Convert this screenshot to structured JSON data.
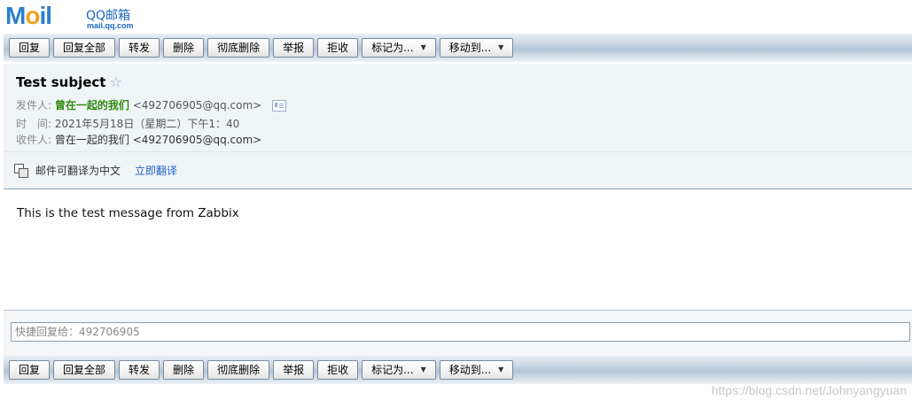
{
  "logo": {
    "text_m": "M",
    "text_o": "o",
    "text_il": "il",
    "cn": "QQ邮箱",
    "sub": "mail.qq.com"
  },
  "toolbar": {
    "reply": "回复",
    "reply_all": "回复全部",
    "forward": "转发",
    "delete": "删除",
    "delete_permanently": "彻底删除",
    "report": "举报",
    "reject": "拒收",
    "mark_as": "标记为...",
    "move_to": "移动到..."
  },
  "message": {
    "subject": "Test subject",
    "star": "☆",
    "from_label": "发件人:",
    "from_name": "曾在一起的我们",
    "from_addr": "<492706905@qq.com>",
    "time_label": "时　间:",
    "time_value": "2021年5月18日（星期二）下午1：40",
    "to_label": "收件人:",
    "to_value": "曾在一起的我们 <492706905@qq.com>",
    "translate_text": "邮件可翻译为中文",
    "translate_link": "立即翻译",
    "body": "This is the test message from Zabbix"
  },
  "quick_reply": {
    "placeholder": "快捷回复给：492706905"
  },
  "watermark": "https://blog.csdn.net/Johnyangyuan"
}
